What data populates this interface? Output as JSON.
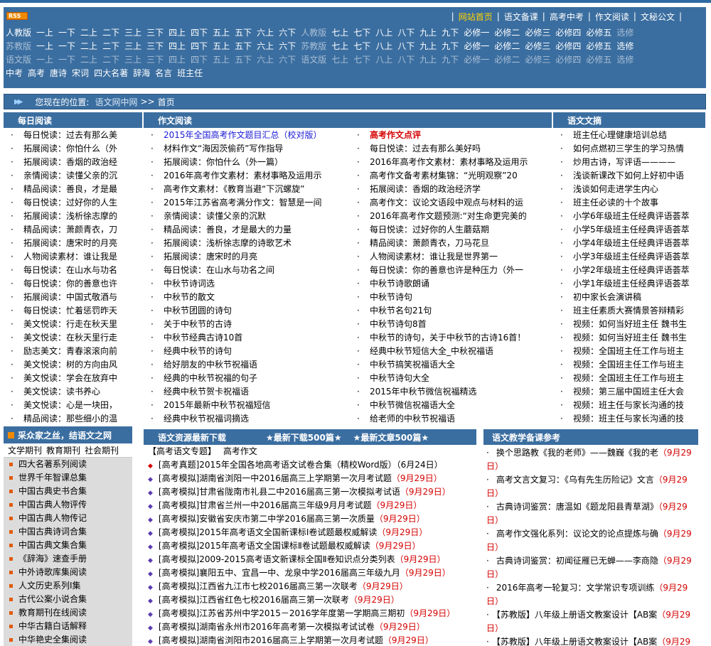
{
  "rss_label": "RSS",
  "top_nav": [
    {
      "label": "网站首页",
      "active": true
    },
    {
      "label": "语文备课",
      "active": false
    },
    {
      "label": "高考中考",
      "active": false
    },
    {
      "label": "作文阅读",
      "active": false
    },
    {
      "label": "文秘公文",
      "active": false
    }
  ],
  "grade_rows": [
    [
      {
        "t": "人教版",
        "dim": false
      },
      {
        "t": "一上",
        "dim": false
      },
      {
        "t": "一下",
        "dim": false
      },
      {
        "t": "二上",
        "dim": false
      },
      {
        "t": "二下",
        "dim": false
      },
      {
        "t": "三上",
        "dim": false
      },
      {
        "t": "三下",
        "dim": false
      },
      {
        "t": "四上",
        "dim": false
      },
      {
        "t": "四下",
        "dim": false
      },
      {
        "t": "五上",
        "dim": false
      },
      {
        "t": "五下",
        "dim": false
      },
      {
        "t": "六上",
        "dim": false
      },
      {
        "t": "六下",
        "dim": false
      },
      {
        "t": "人教版",
        "dim": true
      },
      {
        "t": "七上",
        "dim": false
      },
      {
        "t": "七下",
        "dim": false
      },
      {
        "t": "八上",
        "dim": false
      },
      {
        "t": "八下",
        "dim": false
      },
      {
        "t": "九上",
        "dim": false
      },
      {
        "t": "九下",
        "dim": false
      },
      {
        "t": "必修一",
        "dim": false
      },
      {
        "t": "必修二",
        "dim": false
      },
      {
        "t": "必修三",
        "dim": false
      },
      {
        "t": "必修四",
        "dim": false
      },
      {
        "t": "必修五",
        "dim": false
      },
      {
        "t": "选修",
        "dim": true
      }
    ],
    [
      {
        "t": "苏教版",
        "dim": true
      },
      {
        "t": "一上",
        "dim": false
      },
      {
        "t": "一下",
        "dim": false
      },
      {
        "t": "二上",
        "dim": false
      },
      {
        "t": "二下",
        "dim": false
      },
      {
        "t": "三上",
        "dim": false
      },
      {
        "t": "三下",
        "dim": false
      },
      {
        "t": "四上",
        "dim": false
      },
      {
        "t": "四下",
        "dim": false
      },
      {
        "t": "五上",
        "dim": false
      },
      {
        "t": "五下",
        "dim": false
      },
      {
        "t": "六上",
        "dim": false
      },
      {
        "t": "六下",
        "dim": false
      },
      {
        "t": "苏教版",
        "dim": true
      },
      {
        "t": "七上",
        "dim": false
      },
      {
        "t": "七下",
        "dim": false
      },
      {
        "t": "八上",
        "dim": false
      },
      {
        "t": "八下",
        "dim": false
      },
      {
        "t": "九上",
        "dim": false
      },
      {
        "t": "九下",
        "dim": false
      },
      {
        "t": "必修一",
        "dim": false
      },
      {
        "t": "必修二",
        "dim": false
      },
      {
        "t": "必修三",
        "dim": false
      },
      {
        "t": "必修四",
        "dim": false
      },
      {
        "t": "必修五",
        "dim": false
      },
      {
        "t": "选修",
        "dim": false
      }
    ],
    [
      {
        "t": "语文版",
        "dim": true
      },
      {
        "t": "一上",
        "dim": true
      },
      {
        "t": "一下",
        "dim": true
      },
      {
        "t": "二上",
        "dim": true
      },
      {
        "t": "二下",
        "dim": true
      },
      {
        "t": "三上",
        "dim": true
      },
      {
        "t": "三下",
        "dim": true
      },
      {
        "t": "四上",
        "dim": true
      },
      {
        "t": "四下",
        "dim": true
      },
      {
        "t": "五上",
        "dim": true
      },
      {
        "t": "五下",
        "dim": true
      },
      {
        "t": "六上",
        "dim": true
      },
      {
        "t": "六下",
        "dim": true
      },
      {
        "t": "语文版",
        "dim": true
      },
      {
        "t": "七上",
        "dim": true
      },
      {
        "t": "七下",
        "dim": true
      },
      {
        "t": "八上",
        "dim": true
      },
      {
        "t": "八下",
        "dim": true
      },
      {
        "t": "九上",
        "dim": true
      },
      {
        "t": "九下",
        "dim": true
      },
      {
        "t": "必修一",
        "dim": true
      },
      {
        "t": "必修二",
        "dim": true
      },
      {
        "t": "必修三",
        "dim": true
      },
      {
        "t": "必修四",
        "dim": true
      },
      {
        "t": "必修五",
        "dim": true
      },
      {
        "t": "选修",
        "dim": true
      }
    ],
    [
      {
        "t": "中考",
        "dim": false
      },
      {
        "t": "高考",
        "dim": false
      },
      {
        "t": "唐诗",
        "dim": false
      },
      {
        "t": "宋词",
        "dim": false
      },
      {
        "t": "四大名著",
        "dim": false
      },
      {
        "t": "辞海",
        "dim": false
      },
      {
        "t": "名言",
        "dim": false
      },
      {
        "t": "班主任",
        "dim": false
      }
    ]
  ],
  "breadcrumb": {
    "label": "您现在的位置:",
    "site": "语文网中网",
    "sep": ">>",
    "current": "首页"
  },
  "col1": {
    "title": "每日阅读",
    "items": [
      "每日悦读：过去有那么美",
      "拓展阅读：你怕什么（外",
      "拓展阅读：香烟的政治经",
      "亲情阅读：读懂父亲的沉",
      "精品阅读：善良，才是最",
      "每日悦读：过好你的人生",
      "拓展阅读：浅析徐志摩的",
      "精品阅读：萧颜青衣，刀",
      "拓展阅读：唐宋时的月亮",
      "人物阅读素材：谁让我是",
      "每日悦读：在山水与功名",
      "每日悦读：你的善意也许",
      "拓展阅读：中国式敬酒与",
      "每日悦读：忙着惩罚昨天",
      "美文悦读：行走在秋天里",
      "美文悦读：在秋天里行走",
      "励志美文：青春滚滚向前",
      "美文悦读：树的方向由风",
      "美文悦读：学会在放弃中",
      "美文悦读：读书养心",
      "美文悦读：心是一块田，",
      "精品阅读：那些细小的温"
    ]
  },
  "col2": {
    "title": "作文阅读",
    "items": [
      {
        "t": "2015年全国高考作文题目汇总（校对版）",
        "c": "blue"
      },
      {
        "t": "材料作文“海因茨偷药”写作指导",
        "c": ""
      },
      {
        "t": "拓展阅读：你怕什么（外一篇）",
        "c": ""
      },
      {
        "t": "2016年高考作文素材：素材事略及运用示",
        "c": ""
      },
      {
        "t": "高考作文素材：《教育当避“下沉螺旋”",
        "c": ""
      },
      {
        "t": "2015年江苏省高考满分作文：智慧是一间",
        "c": ""
      },
      {
        "t": "亲情阅读：读懂父亲的沉默",
        "c": ""
      },
      {
        "t": "精品阅读：善良，才是最大的力量",
        "c": ""
      },
      {
        "t": "拓展阅读：浅析徐志摩的诗歌艺术",
        "c": ""
      },
      {
        "t": "拓展阅读：唐宋时的月亮",
        "c": ""
      },
      {
        "t": "每日悦读：在山水与功名之间",
        "c": ""
      },
      {
        "t": "中秋节诗词选",
        "c": ""
      },
      {
        "t": "中秋节的散文",
        "c": ""
      },
      {
        "t": "中秋节团圆的诗句",
        "c": ""
      },
      {
        "t": "关于中秋节的古诗",
        "c": ""
      },
      {
        "t": "中秋节经典古诗10首",
        "c": ""
      },
      {
        "t": "经典中秋节的诗句",
        "c": ""
      },
      {
        "t": "给好朋友的中秋节祝福语",
        "c": ""
      },
      {
        "t": "经典的中秋节祝福的句子",
        "c": ""
      },
      {
        "t": "经典中秋节贺卡祝福语",
        "c": ""
      },
      {
        "t": "2015年最新中秋节祝福短信",
        "c": ""
      },
      {
        "t": "经典中秋节祝福词摘选",
        "c": ""
      }
    ]
  },
  "col3": {
    "items": [
      {
        "t": "高考作文点评",
        "c": "red bold"
      },
      {
        "t": "每日悦读：过去有那么美好吗",
        "c": ""
      },
      {
        "t": "2016年高考作文素材：素材事略及运用示",
        "c": ""
      },
      {
        "t": "高考作文备考素材集锦：“光明观察”20",
        "c": ""
      },
      {
        "t": "拓展阅读：香烟的政治经济学",
        "c": ""
      },
      {
        "t": "高考作文：议论文语段中观点与材料的运",
        "c": ""
      },
      {
        "t": "2016年高考作文题预测:“对生命更完美的",
        "c": ""
      },
      {
        "t": "每日悦读：过好你的人生蘑菇期",
        "c": ""
      },
      {
        "t": "精品阅读：萧颜青衣，刀马花旦",
        "c": ""
      },
      {
        "t": "人物阅读素材：谁让我是世界第一",
        "c": ""
      },
      {
        "t": "每日悦读：你的善意也许是种压力（外一",
        "c": ""
      },
      {
        "t": "中秋节诗歌朗诵",
        "c": ""
      },
      {
        "t": "中秋节诗句",
        "c": ""
      },
      {
        "t": "中秋节名句21句",
        "c": ""
      },
      {
        "t": "中秋节诗句8首",
        "c": ""
      },
      {
        "t": "中秋节的诗句，关于中秋节的古诗16首！",
        "c": ""
      },
      {
        "t": "经典中秋节短信大全_中秋祝福语",
        "c": ""
      },
      {
        "t": "中秋节搞笑祝福语大全",
        "c": ""
      },
      {
        "t": "中秋节诗句大全",
        "c": ""
      },
      {
        "t": "2015年中秋节微信祝福精选",
        "c": ""
      },
      {
        "t": "中秋节微信祝福语大全",
        "c": ""
      },
      {
        "t": "给老师的中秋节祝福语",
        "c": ""
      }
    ]
  },
  "col4": {
    "title": "语文文摘",
    "items": [
      "班主任心理健康培训总结",
      "如何点燃初三学生的学习热情",
      "炒用古诗，写评语————",
      "浅谈新课改下如何上好初中语",
      "浅谈如何走进学生内心",
      "班主任必读的十个故事",
      "小学6年级班主任经典评语荟萃",
      "小学5年级班主任经典评语荟萃",
      "小学4年级班主任经典评语荟萃",
      "小学3年级班主任经典评语荟萃",
      "小学2年级班主任经典评语荟萃",
      "小学1年级班主任经典评语荟萃",
      "初中家长会演讲稿",
      "班主任素质大赛情景答辩精彩",
      "视频：如何当好班主任 魏书生",
      "视频：如何当好班主任 魏书生",
      "视频：全国班主任工作与班主",
      "视频：全国班主任工作与班主",
      "视频：全国班主任工作与班主",
      "视频：第三届中国班主任大会",
      "视频：班主任与家长沟通的技",
      "视频：班主任与家长沟通的技"
    ]
  },
  "left_box": {
    "title": "采众家之丝，结语文之网",
    "tabs": [
      "文学期刊",
      "教育期刊",
      "社会期刊"
    ],
    "items": [
      "四大名著系列阅读",
      "世界千年智课总集",
      "中国古典史书合集",
      "中国古典人物评传",
      "中国古典人物传记",
      "中国古典诗词合集",
      "中国古典文集合集",
      "《辞海》速查手册",
      "中外诗歌库集阅读",
      "人文历史系列Ⅰ集",
      "古代公案小说合集",
      "教育期刊在线阅读",
      "中华古籍白话解释",
      "中华艳史全集阅读"
    ]
  },
  "downloads": {
    "title": "语文资源最新下载",
    "link1": "★最新下载500篇★",
    "link2": "★最新文章500篇★",
    "topic_label": "【高考语文专题】",
    "topic_value": "高考作文",
    "items": [
      {
        "t": "[高考真题]2015年全国各地高考语文试卷合集（精校Word版）",
        "d": "（6月24日）",
        "dc": ""
      },
      {
        "t": "[高考模拟]湖南省浏阳一中2016届高三上学期第一次月考试题",
        "d": "（9月29日）",
        "dc": "red"
      },
      {
        "t": "[高考模拟]甘肃省陇南市礼县二中2016届高三第一次模拟考试语",
        "d": "（9月29日）",
        "dc": "red"
      },
      {
        "t": "[高考模拟]甘肃省兰州一中2016届高三年级9月月考试题",
        "d": "（9月29日）",
        "dc": "red"
      },
      {
        "t": "[高考模拟]安徽省安庆市第二中学2016届高三第一次质量",
        "d": "（9月29日）",
        "dc": "red"
      },
      {
        "t": "[高考模拟]2015年高考语文全国新课标Ⅰ卷试题最权威解读",
        "d": "（9月29日）",
        "dc": "red"
      },
      {
        "t": "[高考模拟]2015年高考语文全国课标Ⅱ卷试题最权威解读",
        "d": "（9月29日）",
        "dc": "red"
      },
      {
        "t": "[高考模拟]2009-2015高考语文新课标全国Ⅱ卷知识点分类列表",
        "d": "（9月29日）",
        "dc": "red"
      },
      {
        "t": "[高考模拟]襄阳五中、宜昌一中、龙泉中学2016届高三年级九月",
        "d": "（9月29日）",
        "dc": "red"
      },
      {
        "t": "[高考模拟]江西省九江市七校2016届高三第一次联考",
        "d": "（9月29日）",
        "dc": "red"
      },
      {
        "t": "[高考模拟]江西省红色七校2016届高三第一次联考",
        "d": "（9月29日）",
        "dc": "red"
      },
      {
        "t": "[高考模拟]江苏省苏州中学2015－2016学年度第一学期高三期初",
        "d": "（9月29日）",
        "dc": "red"
      },
      {
        "t": "[高考模拟]湖南省永州市2016年高考第一次模拟考试试卷",
        "d": "（9月29日）",
        "dc": "red"
      },
      {
        "t": "[高考模拟]湖南省浏阳市2016届高三上学期第一次月考试题",
        "d": "（9月29日）",
        "dc": "red"
      }
    ]
  },
  "reference": {
    "title": "语文教学备课参考",
    "items": [
      {
        "t": "换个思路教《我的老师》——魏巍《我的老",
        "d": "（9月29日）"
      },
      {
        "t": "高考文言文复习：《乌有先生历险记》文言",
        "d": "（9月29日）"
      },
      {
        "t": "古典诗词鉴赏：唐温如《题龙阳县青草湖》",
        "d": "（9月29日）"
      },
      {
        "t": "高考作文强化系列：议论文的论点提炼与确",
        "d": "（9月29日）"
      },
      {
        "t": "古典诗词鉴赏：初闻征雁已无蝉——李商隐",
        "d": "（9月29日）"
      },
      {
        "t": "2016年高考一轮复习：文学常识专项训练",
        "d": "（9月29日）"
      },
      {
        "t": "【苏教版】八年级上册语文教案设计【AB案",
        "d": "（9月29日）"
      },
      {
        "t": "【苏教版】八年级上册语文教案设计【AB案",
        "d": "（9月29日）"
      }
    ]
  }
}
